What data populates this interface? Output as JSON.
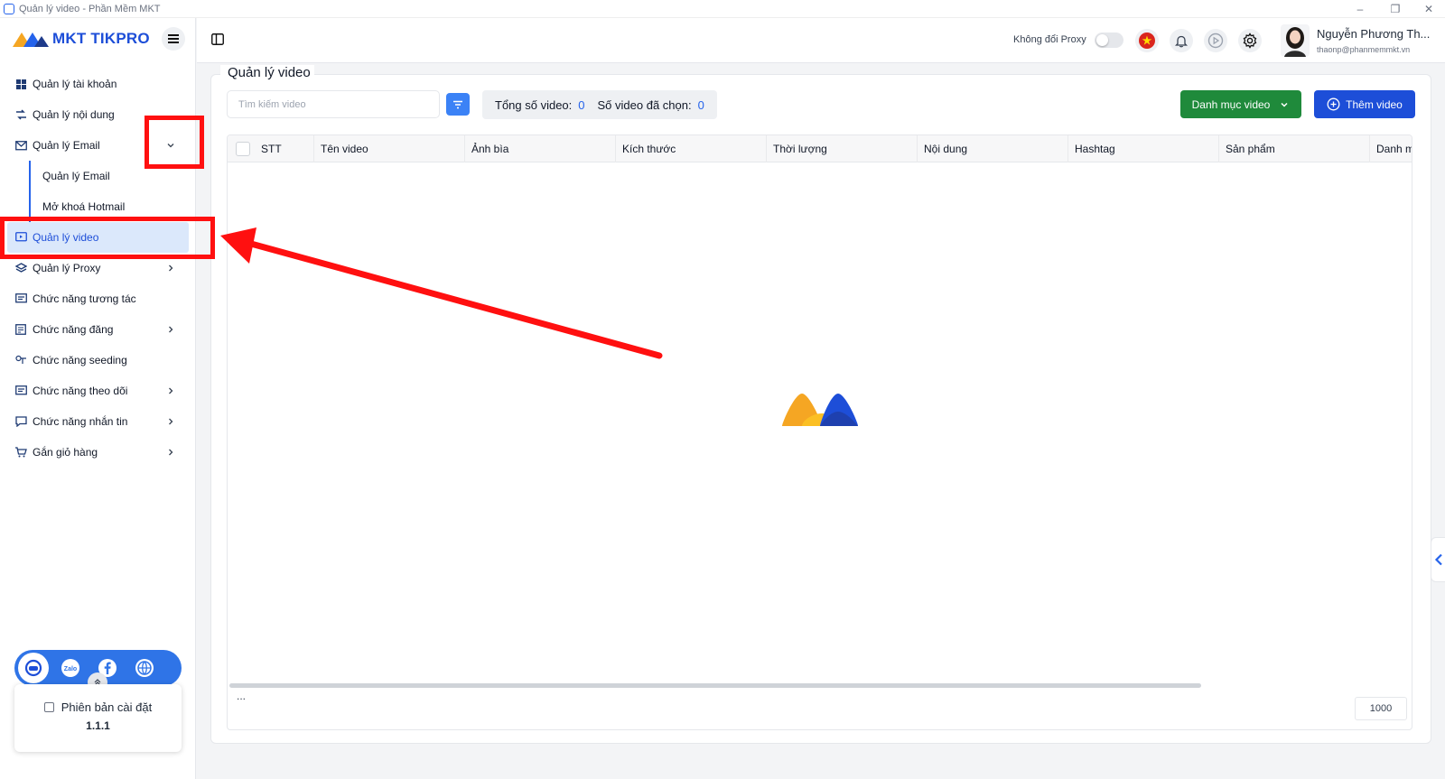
{
  "window": {
    "title": "Quản lý video - Phần Mềm MKT",
    "minimize": "–",
    "restore": "❐",
    "close": "✕"
  },
  "brand": {
    "name": "MKT TIKPRO"
  },
  "sidebar": {
    "items": [
      {
        "label": "Quản lý tài khoản",
        "icon": "grid-icon"
      },
      {
        "label": "Quản lý nội dung",
        "icon": "content-icon"
      },
      {
        "label": "Quản lý Email",
        "icon": "email-icon",
        "expanded": true,
        "children": [
          {
            "label": "Quản lý Email"
          },
          {
            "label": "Mở khoá Hotmail"
          }
        ]
      },
      {
        "label": "Quản lý video",
        "icon": "video-icon",
        "active": true
      },
      {
        "label": "Quản lý Proxy",
        "icon": "proxy-icon",
        "has_children": true
      },
      {
        "label": "Chức năng tương tác",
        "icon": "interact-icon"
      },
      {
        "label": "Chức năng đăng",
        "icon": "post-icon",
        "has_children": true
      },
      {
        "label": "Chức năng seeding",
        "icon": "seeding-icon"
      },
      {
        "label": "Chức năng theo dõi",
        "icon": "follow-icon",
        "has_children": true
      },
      {
        "label": "Chức năng nhắn tin",
        "icon": "message-icon",
        "has_children": true
      },
      {
        "label": "Gắn giỏ hàng",
        "icon": "cart-icon",
        "has_children": true
      }
    ],
    "social": [
      "support-icon",
      "zalo-icon",
      "facebook-icon",
      "globe-icon"
    ],
    "version": {
      "label": "Phiên bản cài đặt",
      "number": "1.1.1"
    },
    "zalo_text": "Zalo"
  },
  "header": {
    "proxy_label": "Không đổi Proxy",
    "proxy_enabled": false,
    "user": {
      "name": "Nguyễn Phương Th...",
      "email": "thaonp@phanmemmkt.vn"
    }
  },
  "page": {
    "title": "Quản lý video",
    "search_placeholder": "Tìm kiếm video",
    "stats": {
      "total_label": "Tổng số video:",
      "total": "0",
      "selected_label": "Số video đã chọn:",
      "selected": "0"
    },
    "category_button": "Danh mục video",
    "add_button": "Thêm video",
    "table": {
      "columns": [
        "STT",
        "Tên video",
        "Ảnh bìa",
        "Kích thước",
        "Thời lượng",
        "Nội dung",
        "Hashtag",
        "Sản phẩm",
        "Danh m"
      ],
      "rows": [],
      "footer_text": "...",
      "page_size": "1000"
    }
  },
  "colors": {
    "primary": "#1d4ed8",
    "success": "#1f8a3b",
    "annotation": "#ff1010",
    "active_bg": "#dbe8fb"
  }
}
